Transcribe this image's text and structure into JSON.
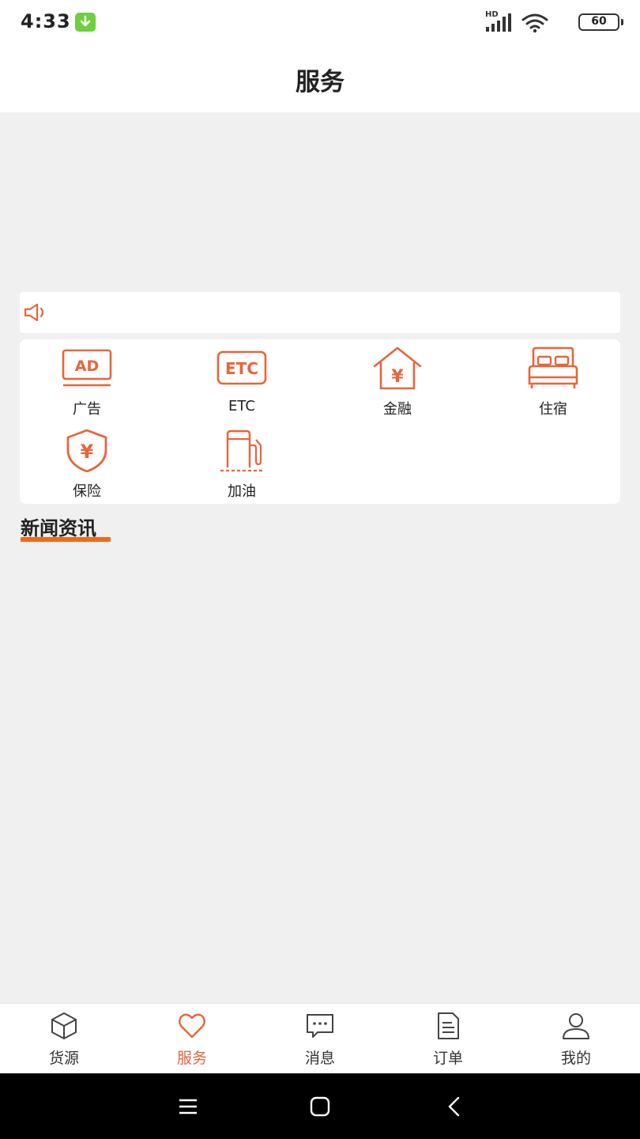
{
  "status_bar": {
    "time": "4:33",
    "hd_label": "HD",
    "battery": "60"
  },
  "header": {
    "title": "服务"
  },
  "services": [
    {
      "label": "广告",
      "icon": "ad-icon",
      "icon_text": "AD"
    },
    {
      "label": "ETC",
      "icon": "etc-icon",
      "icon_text": "ETC"
    },
    {
      "label": "金融",
      "icon": "finance-house-icon",
      "icon_text": "¥"
    },
    {
      "label": "住宿",
      "icon": "bed-icon"
    },
    {
      "label": "保险",
      "icon": "insurance-shield-icon",
      "icon_text": "¥"
    },
    {
      "label": "加油",
      "icon": "fuel-pump-icon"
    }
  ],
  "news": {
    "title": "新闻资讯"
  },
  "tabs": [
    {
      "label": "货源",
      "icon": "box-icon",
      "active": false
    },
    {
      "label": "服务",
      "icon": "heart-icon",
      "active": true
    },
    {
      "label": "消息",
      "icon": "message-icon",
      "active": false
    },
    {
      "label": "订单",
      "icon": "document-icon",
      "active": false
    },
    {
      "label": "我的",
      "icon": "user-icon",
      "active": false
    }
  ],
  "colors": {
    "accent": "#ee6a1b",
    "icon_orange": "#e8653a",
    "background": "#f0f0f0"
  }
}
